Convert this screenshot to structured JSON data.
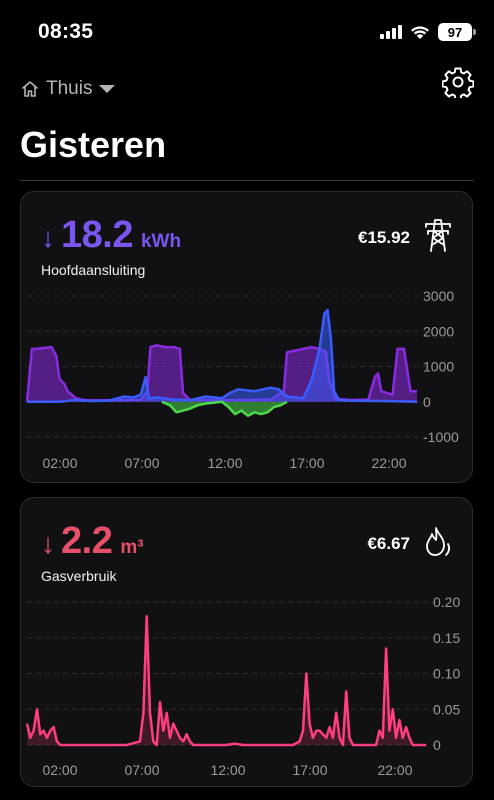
{
  "status": {
    "time": "08:35",
    "battery": "97"
  },
  "header": {
    "location": "Thuis",
    "title": "Gisteren"
  },
  "electricity": {
    "arrow": "↓",
    "value": "18.2",
    "unit": "kWh",
    "label": "Hoofdaansluiting",
    "cost": "€15.92",
    "icon": "power-pylon-icon",
    "accent": "#7b55f0",
    "chart_data": {
      "type": "area",
      "x_ticks": [
        "02:00",
        "07:00",
        "12:00",
        "17:00",
        "22:00"
      ],
      "y_ticks": [
        "3000",
        "2000",
        "1000",
        "0",
        "-1000"
      ],
      "ylim": [
        -1000,
        3000
      ],
      "xlim": [
        0,
        24
      ],
      "series": [
        {
          "color": "#8a2be2",
          "x": [
            0,
            0.3,
            0.5,
            1.5,
            1.8,
            2.0,
            2.3,
            2.5,
            3.0,
            3.5,
            4.0,
            5.0,
            6.0,
            7.0,
            7.4,
            7.6,
            8.0,
            8.5,
            9.0,
            9.4,
            9.6,
            10,
            12,
            15,
            15.8,
            16,
            16.5,
            17,
            17.5,
            18,
            18.4,
            18.6,
            19,
            20,
            21,
            21.4,
            21.6,
            21.8,
            22.5,
            22.8,
            23.2,
            23.6,
            24
          ],
          "y": [
            0,
            1500,
            1500,
            1550,
            1300,
            650,
            500,
            300,
            100,
            50,
            40,
            40,
            40,
            60,
            300,
            1550,
            1600,
            1550,
            1550,
            1500,
            250,
            60,
            40,
            60,
            300,
            1400,
            1450,
            1500,
            1550,
            1500,
            1400,
            600,
            80,
            50,
            60,
            700,
            800,
            300,
            200,
            1500,
            1500,
            300,
            300
          ]
        },
        {
          "color": "#3b5cff",
          "x": [
            0,
            2,
            3,
            4,
            5,
            6,
            6.5,
            7,
            7.3,
            7.5,
            8,
            9,
            10,
            11,
            12,
            12.5,
            13,
            14,
            15,
            15.5,
            16,
            17,
            17.5,
            18,
            18.3,
            18.5,
            18.7,
            18.9,
            19.2,
            20,
            22,
            23,
            24
          ],
          "y": [
            0,
            0,
            50,
            20,
            30,
            150,
            120,
            200,
            700,
            100,
            120,
            60,
            40,
            150,
            100,
            250,
            350,
            300,
            400,
            350,
            150,
            100,
            600,
            1500,
            2500,
            2600,
            1800,
            300,
            50,
            30,
            20,
            10,
            0
          ]
        },
        {
          "color": "#4bd84b",
          "x": [
            8.3,
            8.8,
            9.2,
            9.6,
            10,
            10.5,
            11,
            12,
            12.4,
            12.8,
            13.2,
            13.6,
            14,
            14.4,
            14.8,
            15.2,
            15.6,
            16
          ],
          "y": [
            0,
            -100,
            -300,
            -250,
            -200,
            -100,
            -50,
            0,
            -150,
            -350,
            -250,
            -400,
            -300,
            -350,
            -300,
            -150,
            -100,
            0
          ]
        }
      ]
    }
  },
  "gas": {
    "arrow": "↓",
    "value": "2.2",
    "unit": "m³",
    "label": "Gasverbruik",
    "cost": "€6.67",
    "icon": "flame-icon",
    "accent": "#e8506a",
    "chart_data": {
      "type": "line",
      "x_ticks": [
        "02:00",
        "07:00",
        "12:00",
        "17:00",
        "22:00"
      ],
      "y_ticks": [
        "0.20",
        "0.15",
        "0.10",
        "0.05",
        "0"
      ],
      "ylim": [
        0,
        0.2
      ],
      "xlim": [
        0,
        24
      ],
      "series": [
        {
          "color": "#ff3e7f",
          "x": [
            0,
            0.2,
            0.4,
            0.6,
            0.8,
            1.0,
            1.2,
            1.4,
            1.6,
            1.8,
            2.0,
            2.2,
            2.4,
            2.6,
            3.0,
            4.0,
            5.0,
            6.0,
            6.8,
            7.0,
            7.2,
            7.4,
            7.6,
            7.8,
            8.0,
            8.2,
            8.4,
            8.6,
            8.8,
            9.0,
            9.2,
            9.4,
            9.6,
            9.8,
            10.0,
            11.0,
            12.0,
            12.5,
            13.0,
            14.0,
            15.0,
            16.0,
            16.4,
            16.6,
            16.8,
            17.0,
            17.2,
            17.4,
            17.6,
            17.8,
            18.0,
            18.2,
            18.4,
            18.6,
            18.8,
            19.0,
            19.2,
            19.4,
            19.6,
            20.0,
            21.0,
            21.2,
            21.4,
            21.6,
            21.8,
            22.0,
            22.2,
            22.4,
            22.6,
            22.8,
            23.0,
            23.2,
            23.6,
            24
          ],
          "y": [
            0.03,
            0.01,
            0.02,
            0.05,
            0.015,
            0.02,
            0.01,
            0.02,
            0.025,
            0.005,
            0.0,
            0.0,
            0.0,
            0.0,
            0.0,
            0.0,
            0.0,
            0.0,
            0.005,
            0.045,
            0.18,
            0.045,
            0.005,
            0.0,
            0.06,
            0.02,
            0.045,
            0.01,
            0.03,
            0.02,
            0.01,
            0.005,
            0.015,
            0.005,
            0.0,
            0.0,
            0.0,
            0.002,
            0.0,
            0.0,
            0.0,
            0.0,
            0.005,
            0.02,
            0.1,
            0.03,
            0.01,
            0.02,
            0.02,
            0.015,
            0.01,
            0.025,
            0.01,
            0.045,
            0.01,
            0.0,
            0.075,
            0.01,
            0.0,
            0.0,
            0.0,
            0.02,
            0.01,
            0.135,
            0.02,
            0.05,
            0.01,
            0.035,
            0.01,
            0.025,
            0.01,
            0.0,
            0.0,
            0.0
          ]
        }
      ]
    }
  }
}
